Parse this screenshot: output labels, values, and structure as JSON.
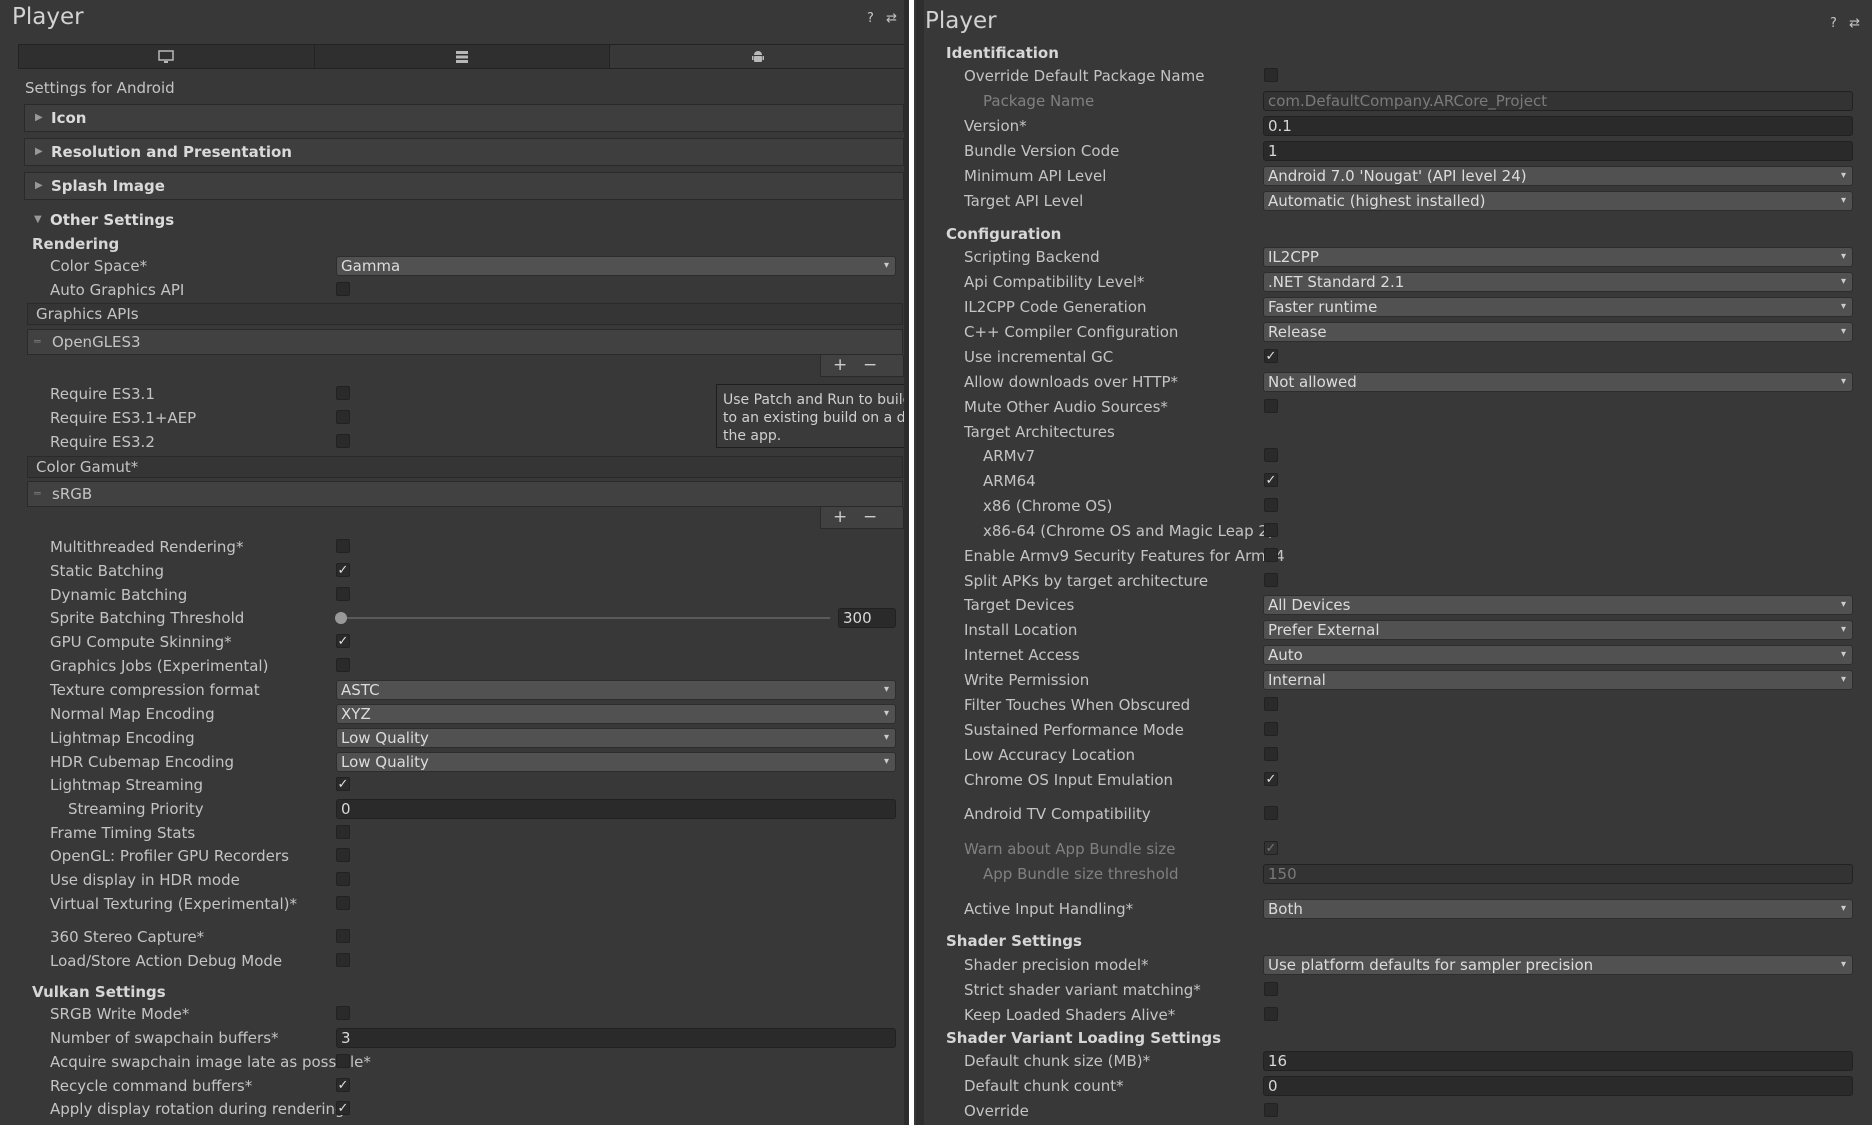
{
  "left": {
    "title": "Player",
    "tabs": [
      {
        "icon": "monitor-icon"
      },
      {
        "icon": "grid-icon"
      },
      {
        "icon": "android-icon"
      }
    ],
    "settings_for": "Settings for Android",
    "folds": [
      {
        "label": "Icon"
      },
      {
        "label": "Resolution and Presentation"
      },
      {
        "label": "Splash Image"
      }
    ],
    "other_settings": "Other Settings",
    "rendering": "Rendering",
    "color_space_label": "Color Space*",
    "color_space_value": "Gamma",
    "auto_graphics_api": "Auto Graphics API",
    "graphics_apis": "Graphics APIs",
    "graphics_api_item": "OpenGLES3",
    "plus": "+",
    "minus": "−",
    "require_es31": "Require ES3.1",
    "require_es31aep": "Require ES3.1+AEP",
    "require_es32": "Require ES3.2",
    "tooltip_line1": "Use Patch and Run to build o",
    "tooltip_line2": "to an existing build on a devi",
    "tooltip_line3": "the app.",
    "color_gamut": "Color Gamut*",
    "color_gamut_item": "sRGB",
    "multithreaded": "Multithreaded Rendering*",
    "static_batching": "Static Batching",
    "dynamic_batching": "Dynamic Batching",
    "sprite_threshold": "Sprite Batching Threshold",
    "sprite_threshold_value": "300",
    "gpu_skinning": "GPU Compute Skinning*",
    "graphics_jobs": "Graphics Jobs (Experimental)",
    "texture_format": "Texture compression format",
    "texture_format_value": "ASTC",
    "normal_map": "Normal Map Encoding",
    "normal_map_value": "XYZ",
    "lightmap_encoding": "Lightmap Encoding",
    "lightmap_encoding_value": "Low Quality",
    "hdr_cubemap": "HDR Cubemap Encoding",
    "hdr_cubemap_value": "Low Quality",
    "lightmap_streaming": "Lightmap Streaming",
    "streaming_priority": "Streaming Priority",
    "streaming_priority_value": "0",
    "frame_timing": "Frame Timing Stats",
    "opengl_profiler": "OpenGL: Profiler GPU Recorders",
    "hdr_display": "Use display in HDR mode",
    "virtual_texturing": "Virtual Texturing (Experimental)*",
    "stereo_capture": "360 Stereo Capture*",
    "load_store": "Load/Store Action Debug Mode",
    "vulkan_settings": "Vulkan Settings",
    "srgb_write": "SRGB Write Mode*",
    "swapchain_buffers": "Number of swapchain buffers*",
    "swapchain_buffers_value": "3",
    "acquire_late": "Acquire swapchain image late as possible*",
    "recycle_buffers": "Recycle command buffers*",
    "display_rotation": "Apply display rotation during rendering"
  },
  "right": {
    "title": "Player",
    "identification": "Identification",
    "override_package": "Override Default Package Name",
    "package_name": "Package Name",
    "package_name_value": "com.DefaultCompany.ARCore_Project",
    "version": "Version*",
    "version_value": "0.1",
    "bundle_code": "Bundle Version Code",
    "bundle_code_value": "1",
    "min_api": "Minimum API Level",
    "min_api_value": "Android 7.0 'Nougat' (API level 24)",
    "target_api": "Target API Level",
    "target_api_value": "Automatic (highest installed)",
    "configuration": "Configuration",
    "scripting_backend": "Scripting Backend",
    "scripting_backend_value": "IL2CPP",
    "api_compat": "Api Compatibility Level*",
    "api_compat_value": ".NET Standard 2.1",
    "il2cpp_codegen": "IL2CPP Code Generation",
    "il2cpp_codegen_value": "Faster runtime",
    "cpp_config": "C++ Compiler Configuration",
    "cpp_config_value": "Release",
    "incremental_gc": "Use incremental GC",
    "http": "Allow downloads over HTTP*",
    "http_value": "Not allowed",
    "mute_audio": "Mute Other Audio Sources*",
    "target_arch": "Target Architectures",
    "armv7": "ARMv7",
    "arm64": "ARM64",
    "x86": "x86 (Chrome OS)",
    "x86_64": "x86-64 (Chrome OS and Magic Leap 2)",
    "armv9": "Enable Armv9 Security Features for Arm64",
    "split_apks": "Split APKs by target architecture",
    "target_devices": "Target Devices",
    "target_devices_value": "All Devices",
    "install_location": "Install Location",
    "install_location_value": "Prefer External",
    "internet_access": "Internet Access",
    "internet_access_value": "Auto",
    "write_permission": "Write Permission",
    "write_permission_value": "Internal",
    "filter_touches": "Filter Touches When Obscured",
    "sustained_perf": "Sustained Performance Mode",
    "low_accuracy": "Low Accuracy Location",
    "chromeos_input": "Chrome OS Input Emulation",
    "android_tv": "Android TV Compatibility",
    "warn_bundle": "Warn about App Bundle size",
    "bundle_threshold": "App Bundle size threshold",
    "bundle_threshold_value": "150",
    "input_handling": "Active Input Handling*",
    "input_handling_value": "Both",
    "shader_settings": "Shader Settings",
    "shader_precision": "Shader precision model*",
    "shader_precision_value": "Use platform defaults for sampler precision",
    "strict_shader": "Strict shader variant matching*",
    "keep_shaders": "Keep Loaded Shaders Alive*",
    "shader_loading": "Shader Variant Loading Settings",
    "chunk_size": "Default chunk size (MB)*",
    "chunk_size_value": "16",
    "chunk_count": "Default chunk count*",
    "chunk_count_value": "0",
    "override": "Override"
  },
  "icons": {
    "help": "?",
    "settings": "⇄",
    "check": "✓",
    "dropdown": "▾",
    "fold_closed": "▶",
    "fold_open": "▼"
  }
}
